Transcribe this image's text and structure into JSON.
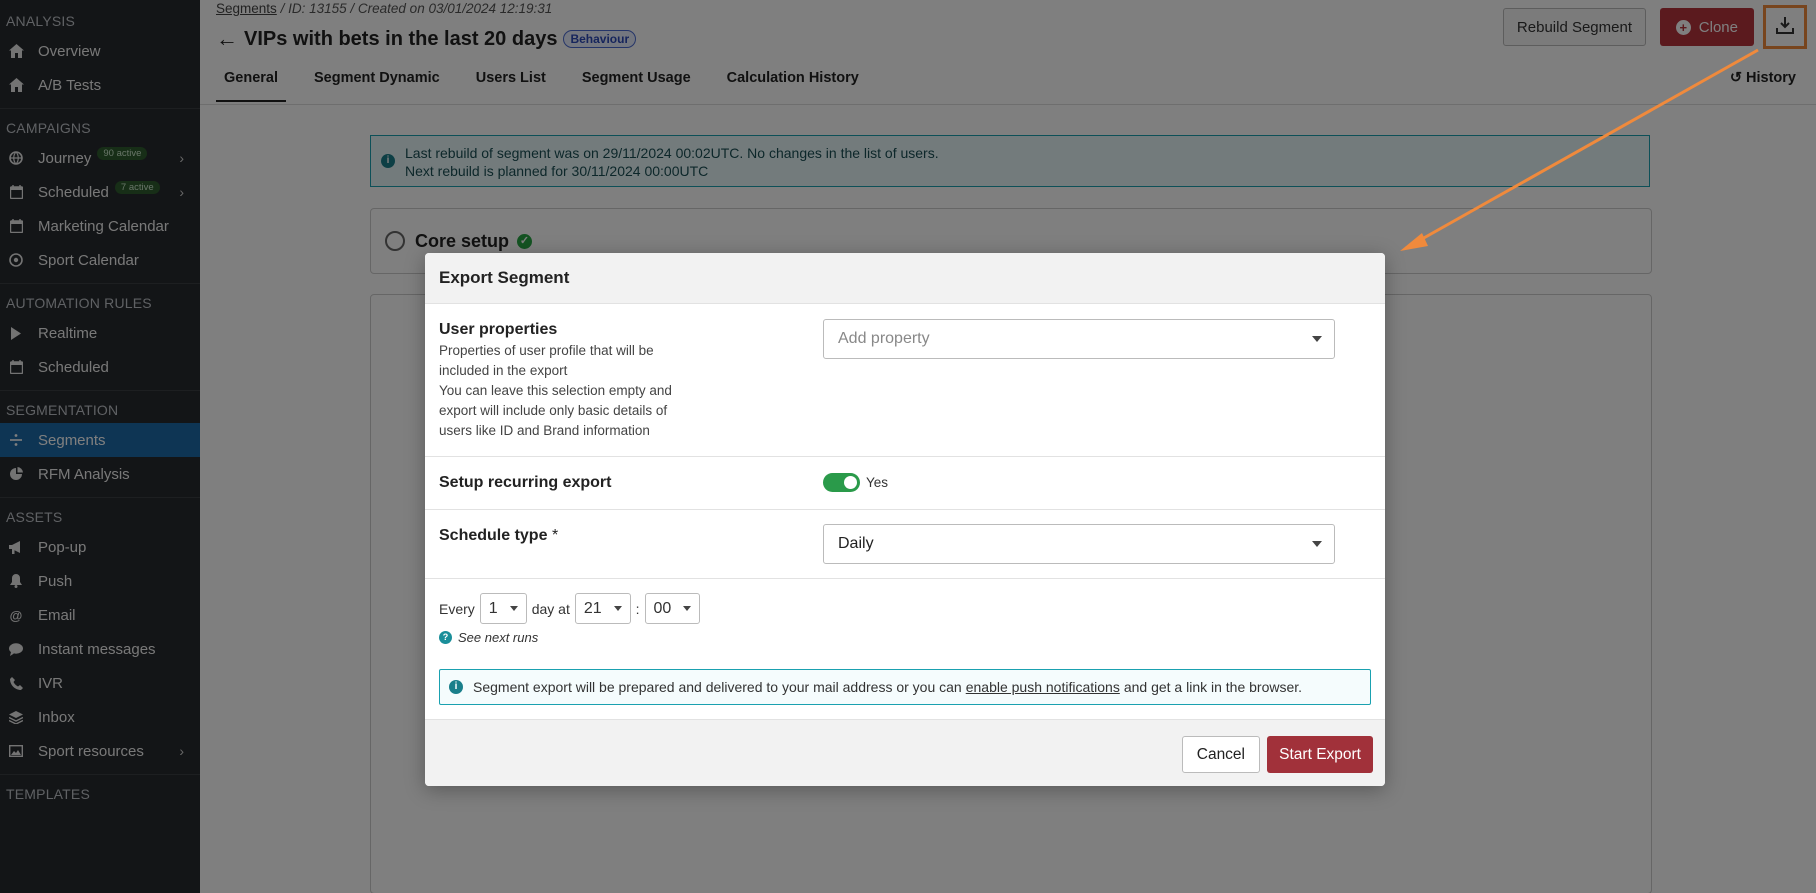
{
  "sidebar": {
    "sections": [
      {
        "title": "ANALYSIS",
        "items": [
          {
            "label": "Overview",
            "icon": "home-icon"
          },
          {
            "label": "A/B Tests",
            "icon": "home-icon"
          }
        ]
      },
      {
        "title": "CAMPAIGNS",
        "items": [
          {
            "label": "Journey",
            "icon": "globe-icon",
            "badge": "90 active",
            "chevron": true
          },
          {
            "label": "Scheduled",
            "icon": "calendar-icon",
            "badge": "7 active",
            "chevron": true
          },
          {
            "label": "Marketing Calendar",
            "icon": "calendar-icon"
          },
          {
            "label": "Sport Calendar",
            "icon": "ball-icon"
          }
        ]
      },
      {
        "title": "AUTOMATION RULES",
        "items": [
          {
            "label": "Realtime",
            "icon": "play-icon"
          },
          {
            "label": "Scheduled",
            "icon": "calendar-icon"
          }
        ]
      },
      {
        "title": "SEGMENTATION",
        "items": [
          {
            "label": "Segments",
            "icon": "divide-icon",
            "active": true
          },
          {
            "label": "RFM Analysis",
            "icon": "pie-icon"
          }
        ]
      },
      {
        "title": "ASSETS",
        "items": [
          {
            "label": "Pop-up",
            "icon": "megaphone-icon"
          },
          {
            "label": "Push",
            "icon": "bell-icon"
          },
          {
            "label": "Email",
            "icon": "at-icon"
          },
          {
            "label": "Instant messages",
            "icon": "chat-icon"
          },
          {
            "label": "IVR",
            "icon": "phone-icon"
          },
          {
            "label": "Inbox",
            "icon": "layers-icon"
          },
          {
            "label": "Sport resources",
            "icon": "image-icon",
            "chevron": true
          }
        ]
      },
      {
        "title": "TEMPLATES",
        "items": []
      }
    ]
  },
  "header": {
    "breadcrumb_link": "Segments",
    "breadcrumb_id": "ID: 13155",
    "breadcrumb_created": "Created on 03/01/2024 12:19:31",
    "title": "VIPs with bets in the last 20 days",
    "tag": "Behaviour",
    "rebuild_label": "Rebuild Segment",
    "clone_label": "Clone",
    "history_label": "History",
    "tabs": [
      "General",
      "Segment Dynamic",
      "Users List",
      "Segment Usage",
      "Calculation History"
    ]
  },
  "banner": {
    "line1": "Last rebuild of segment was on 29/11/2024 00:02UTC. No changes in the list of users.",
    "line2": "Next rebuild is planned for 30/11/2024 00:00UTC"
  },
  "cards": {
    "core_setup": "Core setup"
  },
  "modal": {
    "title": "Export Segment",
    "user_properties_label": "User properties",
    "user_properties_desc1": "Properties of user profile that will be included in the export",
    "user_properties_desc2": "You can leave this selection empty and export will include only basic details of users like ID and Brand information",
    "add_property_placeholder": "Add property",
    "recurring_label": "Setup recurring export",
    "recurring_value": "Yes",
    "schedule_type_label": "Schedule type",
    "schedule_type_required": "*",
    "schedule_type_value": "Daily",
    "every_label": "Every",
    "every_value": "1",
    "day_at_label": "day at",
    "hour_value": "21",
    "colon": ":",
    "minute_value": "00",
    "see_next_runs": "See next runs",
    "info_before": "Segment export will be prepared and delivered to your mail address or you can",
    "info_link": "enable push notifications",
    "info_after": "and get a link in the browser.",
    "cancel_label": "Cancel",
    "start_label": "Start Export"
  },
  "colors": {
    "sidebar_bg": "#272a2e",
    "active_item": "#1c6aa8",
    "primary_red": "#a1313a",
    "toggle_on": "#2a9a4a",
    "info_border": "#1aa1b0",
    "annotation_orange": "#f08a3c"
  }
}
